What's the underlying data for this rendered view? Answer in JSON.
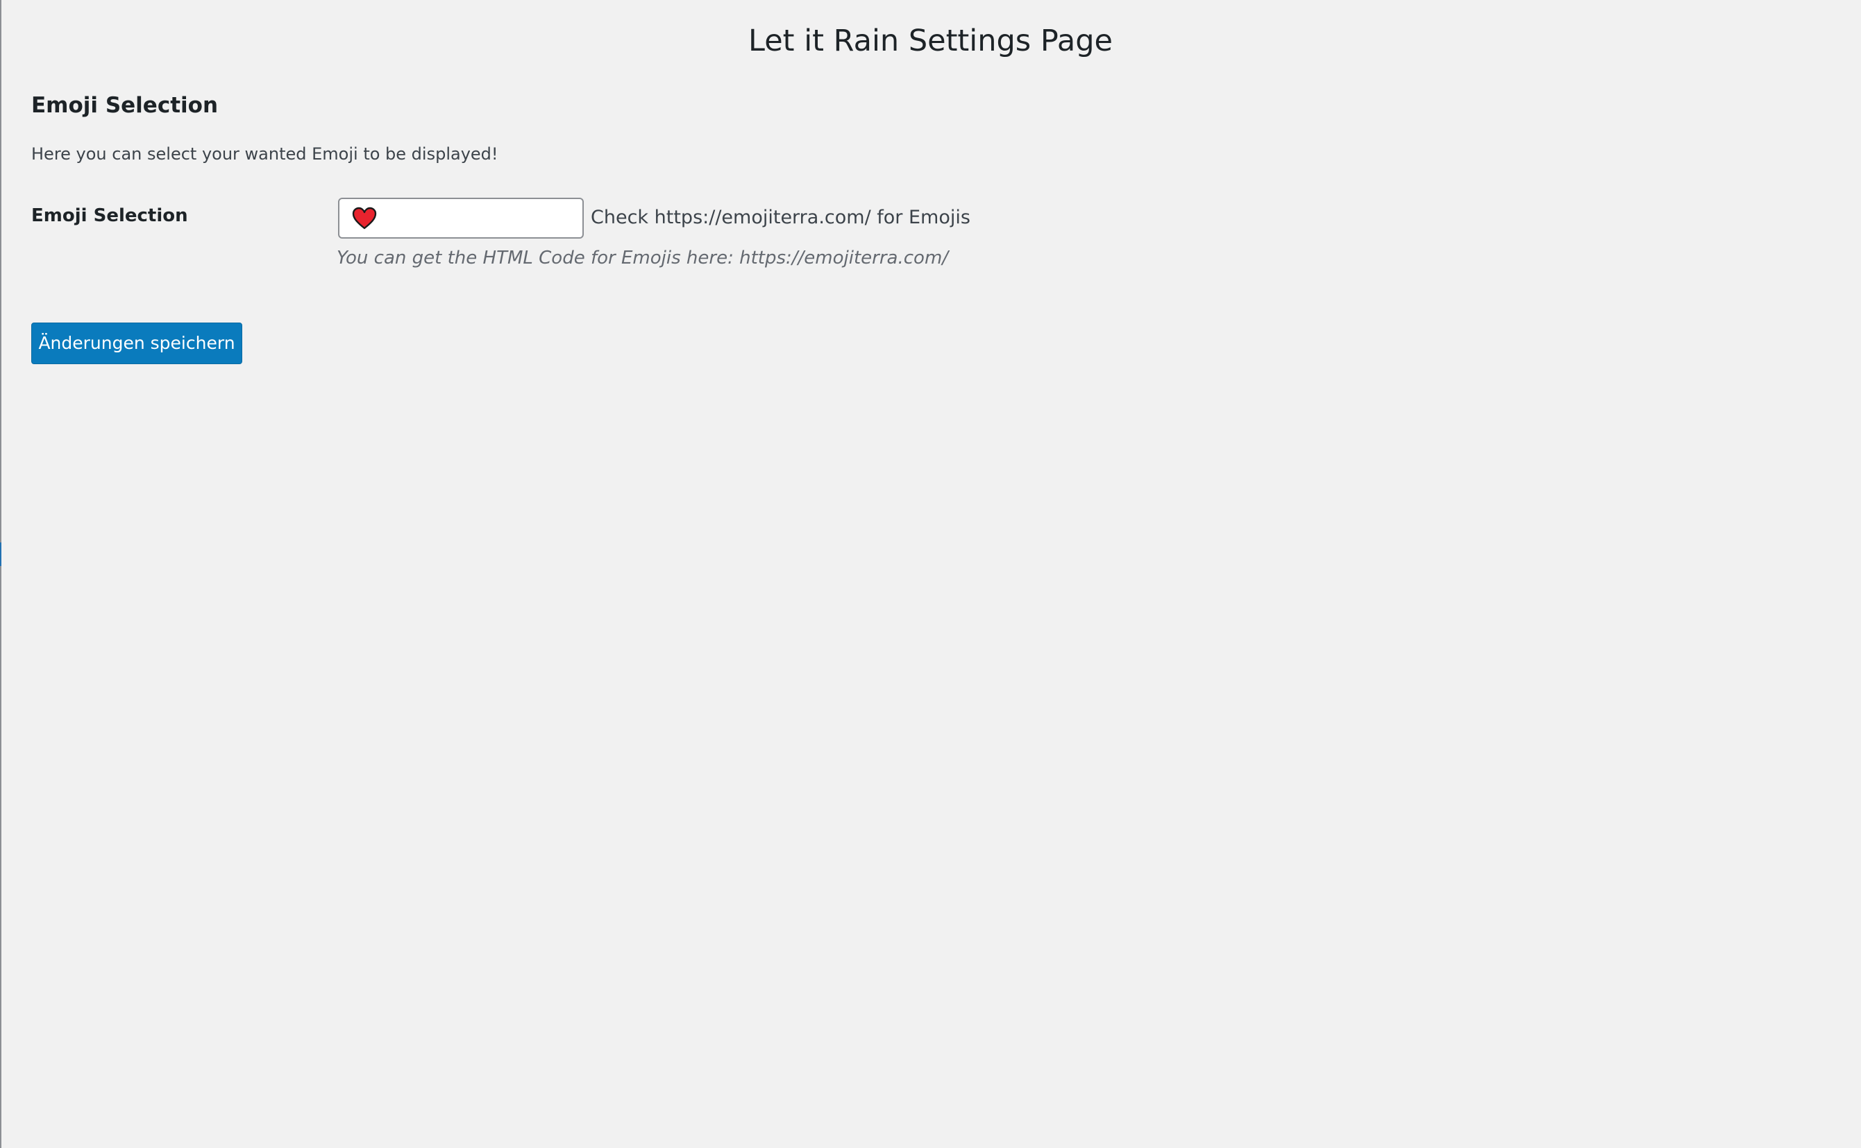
{
  "page": {
    "title": "Let it Rain Settings Page"
  },
  "section": {
    "title": "Emoji Selection",
    "description": "Here you can select your wanted Emoji to be displayed!"
  },
  "field": {
    "label": "Emoji Selection",
    "value_icon": "red-heart-emoji-icon",
    "hint": "Check https://emojiterra.com/ for Emojis",
    "description": "You can get the HTML Code for Emojis here: https://emojiterra.com/"
  },
  "actions": {
    "save_label": "Änderungen speichern"
  },
  "colors": {
    "background": "#f1f1f1",
    "primary_button": "#0a7bbd",
    "heart": "#e8232e"
  }
}
